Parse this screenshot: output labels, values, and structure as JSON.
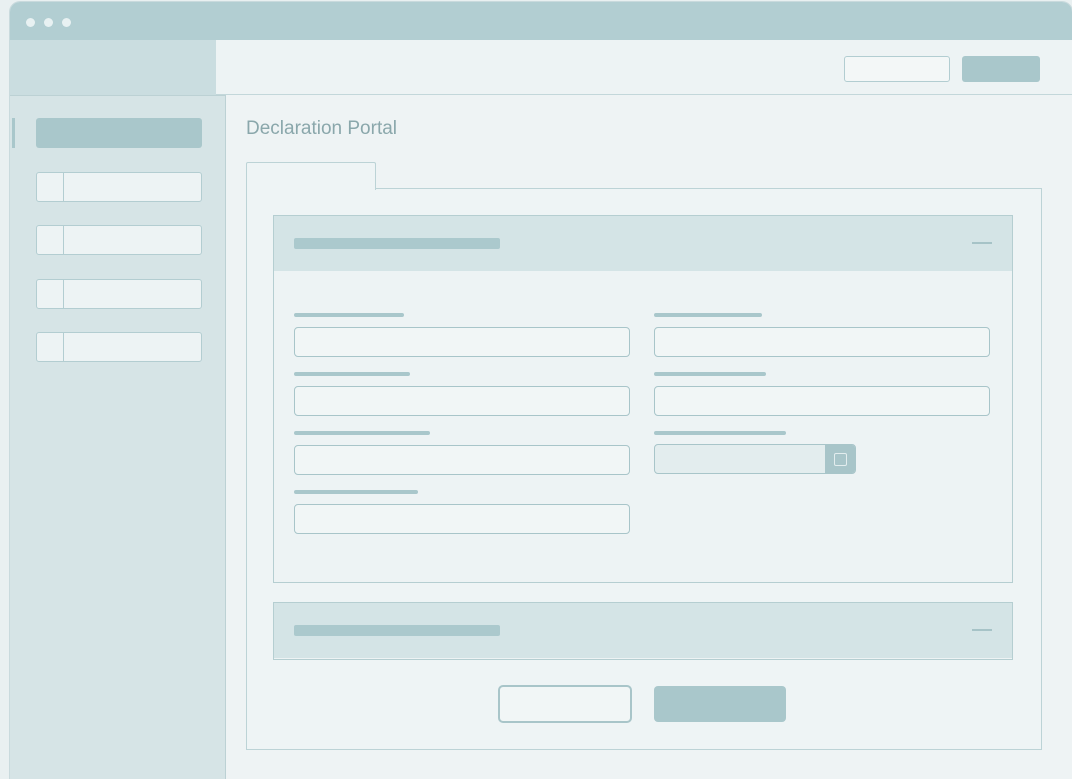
{
  "page": {
    "title": "Declaration Portal"
  },
  "colors": {
    "titlebar": "#b2ced2",
    "accent": "#a9c7cb",
    "background": "#eef3f4",
    "sidebar": "#d6e4e6",
    "title_text": "#8aa7ab"
  },
  "sidebar": {
    "items": [
      {
        "state": "active"
      },
      {
        "state": "inactive",
        "icon": "nav-icon"
      },
      {
        "state": "inactive",
        "icon": "nav-icon"
      },
      {
        "state": "inactive",
        "icon": "nav-icon"
      },
      {
        "state": "inactive",
        "icon": "nav-icon"
      }
    ]
  },
  "sections": [
    {
      "expanded": true,
      "icon": "collapse-icon"
    },
    {
      "expanded": false,
      "icon": "collapse-icon"
    }
  ],
  "icons": {
    "window_controls": [
      "window-dot-icon",
      "window-dot-icon",
      "window-dot-icon"
    ],
    "date_picker": "calendar-icon"
  }
}
